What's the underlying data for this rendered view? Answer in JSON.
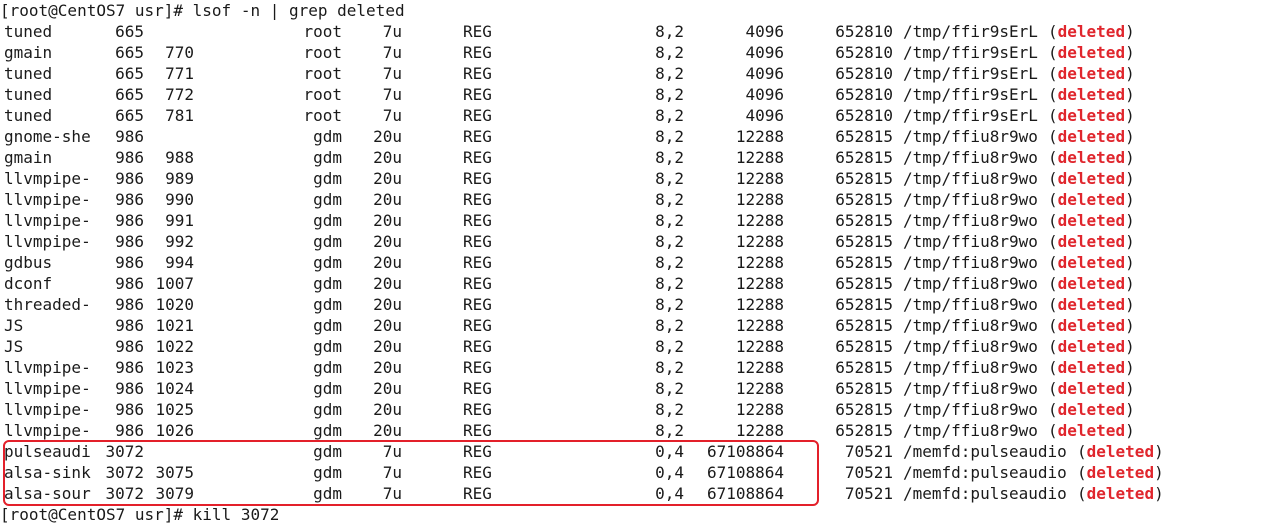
{
  "terminal": {
    "prompt": "[root@CentOS7 usr]# lsof -n | grep deleted",
    "partial_last_line": "[root@CentOS7 usr]# kill 3072",
    "rows": [
      {
        "command": "tuned",
        "pid": "665",
        "tid": "",
        "user": "root",
        "fd": "7u",
        "type": "REG",
        "device": "8,2",
        "size": "4096",
        "node": "652810",
        "name": "/tmp/ffir9sErL",
        "status": "deleted"
      },
      {
        "command": "gmain",
        "pid": "665",
        "tid": "770",
        "user": "root",
        "fd": "7u",
        "type": "REG",
        "device": "8,2",
        "size": "4096",
        "node": "652810",
        "name": "/tmp/ffir9sErL",
        "status": "deleted"
      },
      {
        "command": "tuned",
        "pid": "665",
        "tid": "771",
        "user": "root",
        "fd": "7u",
        "type": "REG",
        "device": "8,2",
        "size": "4096",
        "node": "652810",
        "name": "/tmp/ffir9sErL",
        "status": "deleted"
      },
      {
        "command": "tuned",
        "pid": "665",
        "tid": "772",
        "user": "root",
        "fd": "7u",
        "type": "REG",
        "device": "8,2",
        "size": "4096",
        "node": "652810",
        "name": "/tmp/ffir9sErL",
        "status": "deleted"
      },
      {
        "command": "tuned",
        "pid": "665",
        "tid": "781",
        "user": "root",
        "fd": "7u",
        "type": "REG",
        "device": "8,2",
        "size": "4096",
        "node": "652810",
        "name": "/tmp/ffir9sErL",
        "status": "deleted"
      },
      {
        "command": "gnome-she",
        "pid": "986",
        "tid": "",
        "user": "gdm",
        "fd": "20u",
        "type": "REG",
        "device": "8,2",
        "size": "12288",
        "node": "652815",
        "name": "/tmp/ffiu8r9wo",
        "status": "deleted"
      },
      {
        "command": "gmain",
        "pid": "986",
        "tid": "988",
        "user": "gdm",
        "fd": "20u",
        "type": "REG",
        "device": "8,2",
        "size": "12288",
        "node": "652815",
        "name": "/tmp/ffiu8r9wo",
        "status": "deleted"
      },
      {
        "command": "llvmpipe-",
        "pid": "986",
        "tid": "989",
        "user": "gdm",
        "fd": "20u",
        "type": "REG",
        "device": "8,2",
        "size": "12288",
        "node": "652815",
        "name": "/tmp/ffiu8r9wo",
        "status": "deleted"
      },
      {
        "command": "llvmpipe-",
        "pid": "986",
        "tid": "990",
        "user": "gdm",
        "fd": "20u",
        "type": "REG",
        "device": "8,2",
        "size": "12288",
        "node": "652815",
        "name": "/tmp/ffiu8r9wo",
        "status": "deleted"
      },
      {
        "command": "llvmpipe-",
        "pid": "986",
        "tid": "991",
        "user": "gdm",
        "fd": "20u",
        "type": "REG",
        "device": "8,2",
        "size": "12288",
        "node": "652815",
        "name": "/tmp/ffiu8r9wo",
        "status": "deleted"
      },
      {
        "command": "llvmpipe-",
        "pid": "986",
        "tid": "992",
        "user": "gdm",
        "fd": "20u",
        "type": "REG",
        "device": "8,2",
        "size": "12288",
        "node": "652815",
        "name": "/tmp/ffiu8r9wo",
        "status": "deleted"
      },
      {
        "command": "gdbus",
        "pid": "986",
        "tid": "994",
        "user": "gdm",
        "fd": "20u",
        "type": "REG",
        "device": "8,2",
        "size": "12288",
        "node": "652815",
        "name": "/tmp/ffiu8r9wo",
        "status": "deleted"
      },
      {
        "command": "dconf",
        "pid": "986",
        "tid": "1007",
        "user": "gdm",
        "fd": "20u",
        "type": "REG",
        "device": "8,2",
        "size": "12288",
        "node": "652815",
        "name": "/tmp/ffiu8r9wo",
        "status": "deleted"
      },
      {
        "command": "threaded-",
        "pid": "986",
        "tid": "1020",
        "user": "gdm",
        "fd": "20u",
        "type": "REG",
        "device": "8,2",
        "size": "12288",
        "node": "652815",
        "name": "/tmp/ffiu8r9wo",
        "status": "deleted"
      },
      {
        "command": "JS",
        "pid": "986",
        "tid": "1021",
        "user": "gdm",
        "fd": "20u",
        "type": "REG",
        "device": "8,2",
        "size": "12288",
        "node": "652815",
        "name": "/tmp/ffiu8r9wo",
        "status": "deleted"
      },
      {
        "command": "JS",
        "pid": "986",
        "tid": "1022",
        "user": "gdm",
        "fd": "20u",
        "type": "REG",
        "device": "8,2",
        "size": "12288",
        "node": "652815",
        "name": "/tmp/ffiu8r9wo",
        "status": "deleted"
      },
      {
        "command": "llvmpipe-",
        "pid": "986",
        "tid": "1023",
        "user": "gdm",
        "fd": "20u",
        "type": "REG",
        "device": "8,2",
        "size": "12288",
        "node": "652815",
        "name": "/tmp/ffiu8r9wo",
        "status": "deleted"
      },
      {
        "command": "llvmpipe-",
        "pid": "986",
        "tid": "1024",
        "user": "gdm",
        "fd": "20u",
        "type": "REG",
        "device": "8,2",
        "size": "12288",
        "node": "652815",
        "name": "/tmp/ffiu8r9wo",
        "status": "deleted"
      },
      {
        "command": "llvmpipe-",
        "pid": "986",
        "tid": "1025",
        "user": "gdm",
        "fd": "20u",
        "type": "REG",
        "device": "8,2",
        "size": "12288",
        "node": "652815",
        "name": "/tmp/ffiu8r9wo",
        "status": "deleted"
      },
      {
        "command": "llvmpipe-",
        "pid": "986",
        "tid": "1026",
        "user": "gdm",
        "fd": "20u",
        "type": "REG",
        "device": "8,2",
        "size": "12288",
        "node": "652815",
        "name": "/tmp/ffiu8r9wo",
        "status": "deleted"
      },
      {
        "command": "pulseaudi",
        "pid": "3072",
        "tid": "",
        "user": "gdm",
        "fd": "7u",
        "type": "REG",
        "device": "0,4",
        "size": "67108864",
        "node": "70521",
        "name": "/memfd:pulseaudio",
        "status": "deleted"
      },
      {
        "command": "alsa-sink",
        "pid": "3072",
        "tid": "3075",
        "user": "gdm",
        "fd": "7u",
        "type": "REG",
        "device": "0,4",
        "size": "67108864",
        "node": "70521",
        "name": "/memfd:pulseaudio",
        "status": "deleted"
      },
      {
        "command": "alsa-sour",
        "pid": "3072",
        "tid": "3079",
        "user": "gdm",
        "fd": "7u",
        "type": "REG",
        "device": "0,4",
        "size": "67108864",
        "node": "70521",
        "name": "/memfd:pulseaudio",
        "status": "deleted"
      }
    ]
  },
  "colors": {
    "background": "#ffffff",
    "text": "#1a1a1a",
    "deleted": "#e0262d",
    "highlight": "#e3202a"
  }
}
